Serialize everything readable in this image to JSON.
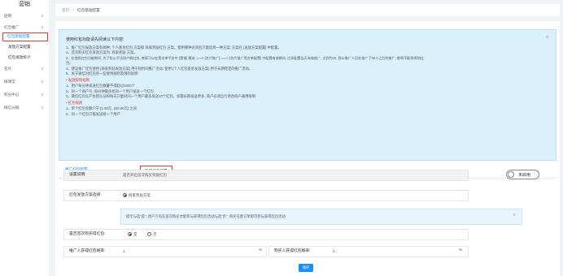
{
  "sidebar": {
    "logo": "营销",
    "items": [
      {
        "label": "促销",
        "chev": "∨"
      },
      {
        "label": "红包推广",
        "chev": "∧"
      },
      {
        "label": "红包基础配置"
      },
      {
        "label": "发放方案配置"
      },
      {
        "label": "红包发放统计"
      },
      {
        "label": "名片",
        "chev": "∨"
      },
      {
        "label": "微课堂",
        "chev": "∨"
      },
      {
        "label": "积分中心",
        "chev": "∨"
      },
      {
        "label": "微信分群",
        "chev": "∨"
      }
    ]
  },
  "breadcrumb": {
    "home": "首页",
    "sep": "/",
    "current": "红包基础配置"
  },
  "notice": {
    "title": "使用红包功能请先阅读以下内容:",
    "lines": [
      "1、推广红包发放方案有两种: 个人基金红包 方案和 商家奖励红包 方案。使用哪种必须且只能选择一种方案; 方案在 [发放方案配置] 中配置。",
      "2、首次购买红包发放方案为: 商家奖励 方案。",
      "3、在使用红包功能期间, 为了防止不法用户刷红包, 商家可以在黑名单平台中 [营销] 模块 ===> [名片推广] ===> [名片推广黑名单配置] 中配置有效期间, 比如配置当天有效推广, 点到为20, 那么推广人员在推广了30人之后的推广, 都将不能再得到红",
      "包。",
      "4、建议推广红包使用 [商家奖励发放方案] 用于短时间推广活动, 使用 [个人红包基金发放方案] 用于长期稳定的推广活动。",
      "5、关于微信对红包的一些使用规则及限制说明:"
    ],
    "sec1": "• 发放限制规则",
    "sec1_lines": [
      "1、用户每分钟发送红包数量不得超过1800个",
      "2、同一个商户号, 每分钟最多给同一个用户发送一个红包",
      "3、微信红包在产生新认证和每天只能对同一个用户最多发送10个红包。如需长期发送更多, 商户必须自行修改商户通用限制"
    ],
    "sec2": "• 红包规则",
    "sec2_lines": [
      "1、单个红包金额介于 [1.00元, 200.00元] 之间",
      "2、同一个红包只能发送给一个用户"
    ],
    "close": "×"
  },
  "tabs": [
    {
      "label": "推广红包配置"
    },
    {
      "label": "购买红包配置"
    }
  ],
  "form": {
    "setting_label": "设置说明:",
    "setting_value": "是否开启首次购买奖励红包",
    "toggle_label": "未启用",
    "scheme_label": "红包发放方案选择:",
    "scheme_option": "商家奖励方案",
    "tip": "提示与选\"是\", 用户只有在首次购买才能参与获得红包活动与选\"否\", 购买任意订单即可参与获得红包活动",
    "tip_close": "×",
    "first_buy_label": "是否首次购买得红包:",
    "yes": "是",
    "no": "否",
    "promoter_label": "推广人获得红包概率:",
    "promoter_value": "1",
    "buyer_label": "购买人获得红包概率:",
    "buyer_value": "1",
    "pct": "%",
    "save": "保存"
  }
}
